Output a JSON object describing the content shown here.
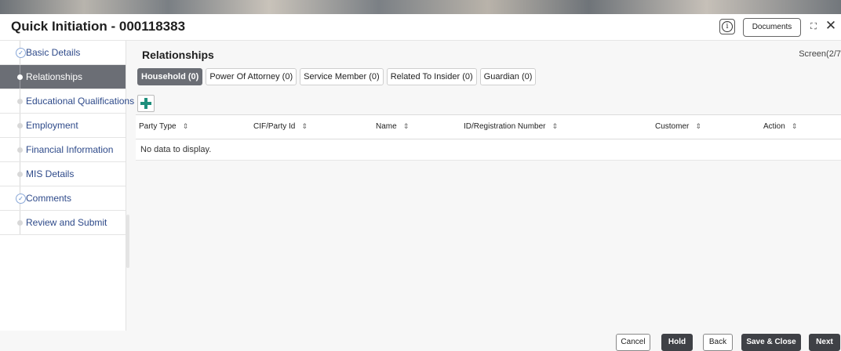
{
  "header": {
    "title": "Quick Initiation - 000118383",
    "info_glyph": "i",
    "documents_label": "Documents",
    "expand_glyph": "⛶",
    "close_glyph": "✕"
  },
  "sidebar": {
    "items": [
      {
        "label": "Basic Details",
        "state": "completed"
      },
      {
        "label": "Relationships",
        "state": "active"
      },
      {
        "label": "Educational Qualifications",
        "state": "pending"
      },
      {
        "label": "Employment",
        "state": "pending"
      },
      {
        "label": "Financial Information",
        "state": "pending"
      },
      {
        "label": "MIS Details",
        "state": "pending"
      },
      {
        "label": "Comments",
        "state": "completed"
      },
      {
        "label": "Review and Submit",
        "state": "pending"
      }
    ]
  },
  "main": {
    "section_title": "Relationships",
    "screen_label": "Screen(2/7",
    "tabs": [
      {
        "label": "Household (0)",
        "active": true
      },
      {
        "label": "Power Of Attorney (0)",
        "active": false
      },
      {
        "label": "Service Member (0)",
        "active": false
      },
      {
        "label": "Related To Insider (0)",
        "active": false
      },
      {
        "label": "Guardian (0)",
        "active": false
      }
    ],
    "table": {
      "columns": [
        "Party Type",
        "CIF/Party Id",
        "Name",
        "ID/Registration Number",
        "Customer",
        "Action"
      ],
      "empty_text": "No data to display."
    }
  },
  "footer": {
    "cancel": "Cancel",
    "hold": "Hold",
    "back": "Back",
    "save_close": "Save & Close",
    "next": "Next"
  },
  "colors": {
    "active_bg": "#6b6e75",
    "add_icon": "#1e8f7c",
    "dark_button": "#3f4146"
  }
}
